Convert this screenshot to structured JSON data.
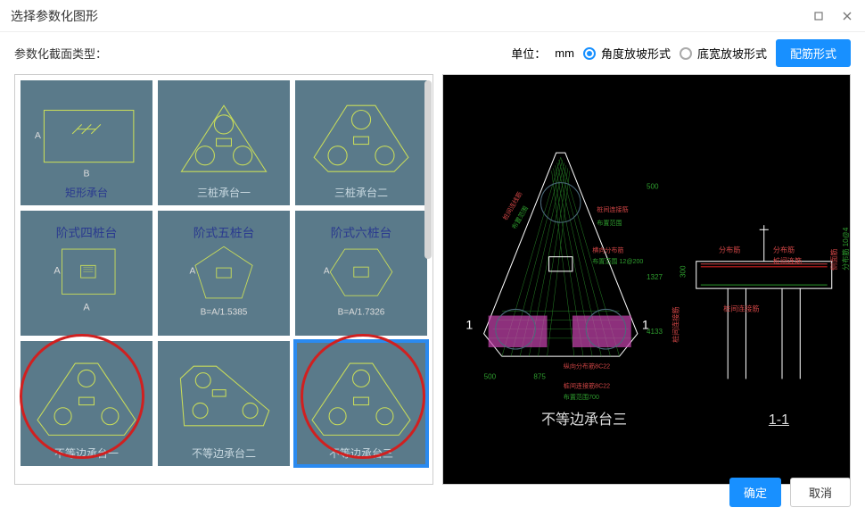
{
  "window": {
    "title": "选择参数化图形"
  },
  "section_label": "参数化截面类型：",
  "unit": {
    "label": "单位：",
    "value": "mm"
  },
  "radios": {
    "opt1": "角度放坡形式",
    "opt2": "底宽放坡形式",
    "selected": "opt1"
  },
  "buttons": {
    "rebar": "配筋形式",
    "ok": "确定",
    "cancel": "取消"
  },
  "thumbs": [
    {
      "id": "t1",
      "label": "矩形承台",
      "label_class": ""
    },
    {
      "id": "t2",
      "label": "三桩承台一",
      "label_class": "light"
    },
    {
      "id": "t3",
      "label": "三桩承台二",
      "label_class": "light"
    },
    {
      "id": "t4",
      "label": "阶式四桩台",
      "sub": "A",
      "label_class": ""
    },
    {
      "id": "t5",
      "label": "阶式五桩台",
      "sub": "B=A/1.5385",
      "label_class": ""
    },
    {
      "id": "t6",
      "label": "阶式六桩台",
      "sub": "B=A/1.7326",
      "label_class": ""
    },
    {
      "id": "t7",
      "label": "不等边承台一",
      "label_class": "light"
    },
    {
      "id": "t8",
      "label": "不等边承台二",
      "label_class": "light"
    },
    {
      "id": "t9",
      "label": "不等边承台三",
      "label_class": "light"
    }
  ],
  "selected_thumb": "t9",
  "preview": {
    "main_label": "不等边承台三",
    "sub_label": "1-1",
    "annotations": {
      "a1": "桩间连线筋",
      "a2": "布置范围",
      "a3": "桩间连接筋",
      "a4": "布置范围",
      "a5": "横向分布筋",
      "a6": "布置范围 12@200",
      "a7": "纵向分布筋8C22",
      "a8": "桩间连接筋8C22",
      "a9": "布置范围700",
      "a10": "分布筋",
      "a11": "桩间连筋",
      "a12": "桩间连接筋",
      "a13": "侧面筋",
      "a14": "分布筋 10@4"
    },
    "dims": {
      "d1": "500",
      "d2": "875",
      "d3": "500",
      "d4": "4133",
      "d5": "1327",
      "d6": "300"
    }
  }
}
